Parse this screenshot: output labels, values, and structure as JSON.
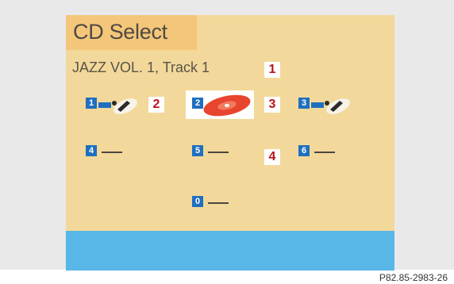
{
  "screen": {
    "title": "CD Select",
    "track_info": "JAZZ VOL. 1, Track 1",
    "slots": [
      {
        "number": "1",
        "icon": "magazine-cd-icon",
        "state": "loaded"
      },
      {
        "number": "2",
        "icon": "cd-disc-icon",
        "state": "selected"
      },
      {
        "number": "3",
        "icon": "magazine-cd-icon",
        "state": "loaded"
      },
      {
        "number": "4",
        "label": "—",
        "state": "empty"
      },
      {
        "number": "5",
        "label": "—",
        "state": "empty"
      },
      {
        "number": "6",
        "label": "—",
        "state": "empty"
      },
      {
        "number": "0",
        "label": "—",
        "state": "empty"
      }
    ]
  },
  "callouts": [
    "1",
    "2",
    "3",
    "4"
  ],
  "reference_code": "P82.85-2983-26",
  "colors": {
    "screen_background": "#f2d89a",
    "title_tab": "#f4c67a",
    "slot_number_bg": "#1f6fc0",
    "callout_text": "#b8141a",
    "status_bar": "#58b7e6",
    "cd_disc": "#e8452e"
  }
}
